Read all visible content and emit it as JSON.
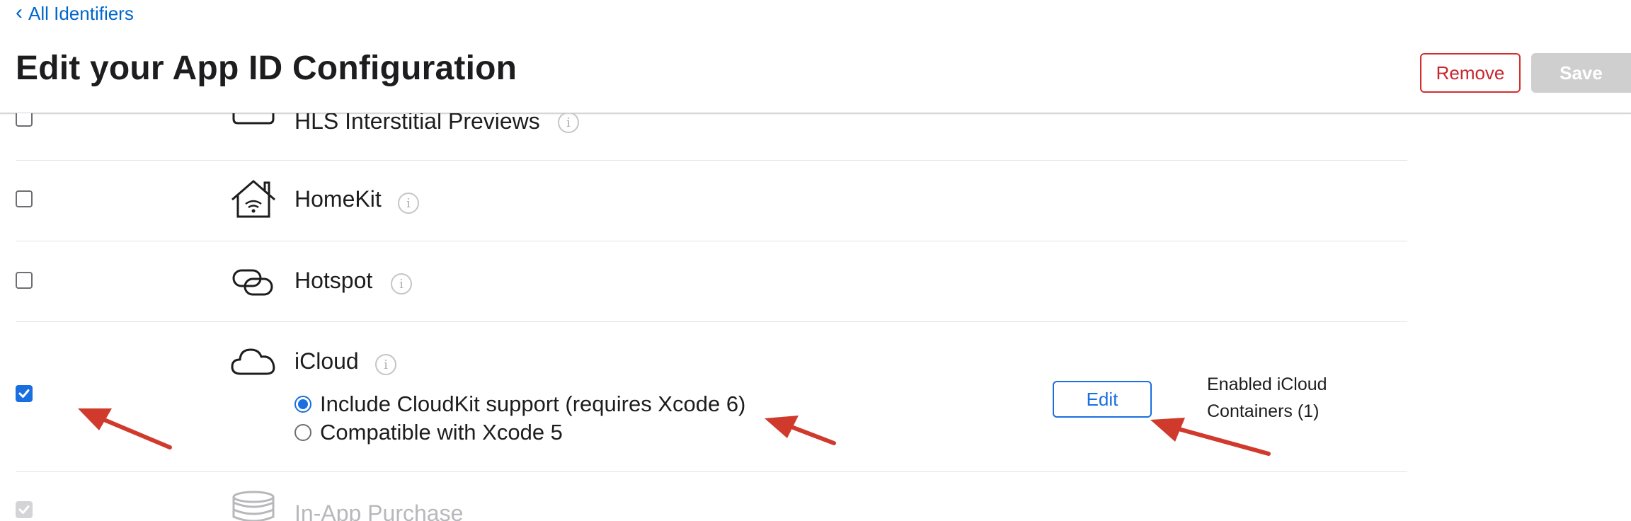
{
  "nav": {
    "back_label": "All Identifiers"
  },
  "header": {
    "title": "Edit your App ID Configuration",
    "remove_label": "Remove",
    "save_label": "Save"
  },
  "capabilities": [
    {
      "name": "HLS Interstitial Previews",
      "checked": false,
      "icon": "hls-preview-icon",
      "partially_visible": true
    },
    {
      "name": "HomeKit",
      "checked": false,
      "icon": "homekit-house-icon"
    },
    {
      "name": "Hotspot",
      "checked": false,
      "icon": "hotspot-link-icon"
    },
    {
      "name": "iCloud",
      "checked": true,
      "icon": "cloud-icon",
      "options": [
        {
          "label": "Include CloudKit support (requires Xcode 6)",
          "selected": true
        },
        {
          "label": "Compatible with Xcode 5",
          "selected": false
        }
      ],
      "edit_label": "Edit",
      "status_text": "Enabled iCloud Containers (1)"
    },
    {
      "name": "In-App Purchase",
      "checked": true,
      "disabled": true,
      "icon": "coins-stack-icon",
      "partially_visible": true
    }
  ],
  "annotations": {
    "arrow_color": "#d03a2c",
    "count": 3
  },
  "colors": {
    "accent": "#1a6fe0",
    "danger": "#c8262d",
    "link": "#0066cc",
    "disabled": "#cfcfcf"
  }
}
